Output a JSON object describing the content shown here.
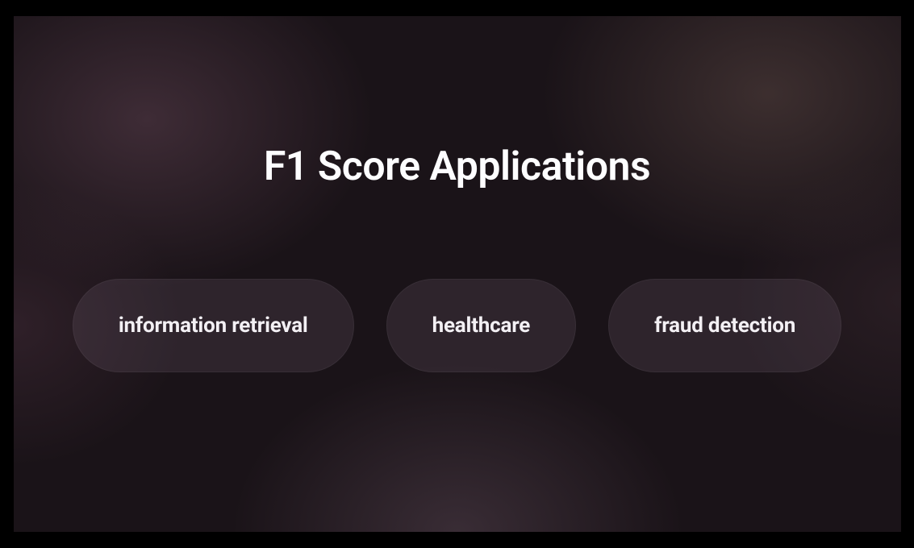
{
  "title": "F1 Score Applications",
  "pills": {
    "item0": "information retrieval",
    "item1": "healthcare",
    "item2": "fraud detection"
  }
}
